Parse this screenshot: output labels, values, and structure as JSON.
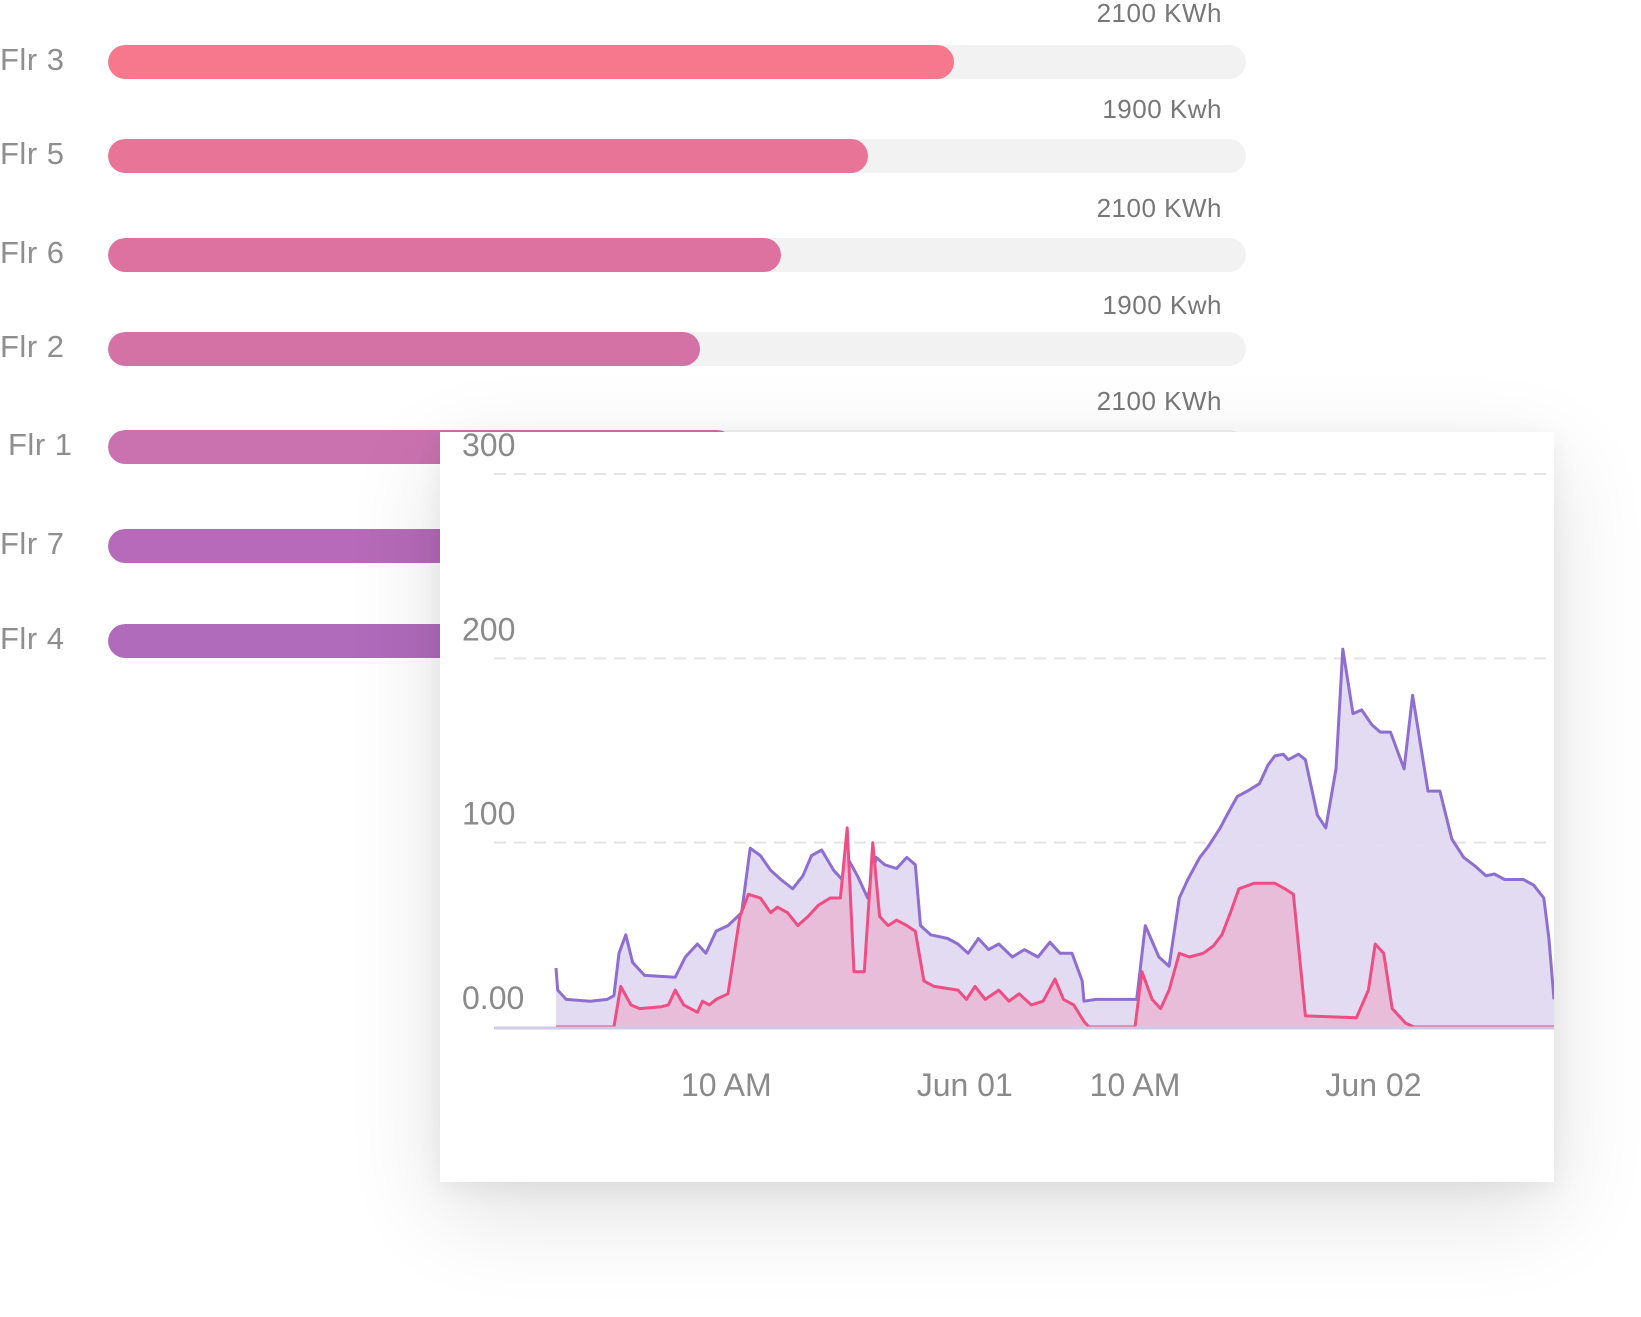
{
  "floors": [
    {
      "label": "Flr 3",
      "value_label": "2100 KWh",
      "fraction": 0.743,
      "color": "#f7778c"
    },
    {
      "label": "Flr 5",
      "value_label": "1900 Kwh",
      "fraction": 0.668,
      "color": "#e87498"
    },
    {
      "label": "Flr 6",
      "value_label": "2100 KWh",
      "fraction": 0.591,
      "color": "#dd72a0"
    },
    {
      "label": "Flr 2",
      "value_label": "1900 Kwh",
      "fraction": 0.52,
      "color": "#d472a6"
    },
    {
      "label": "Flr 1",
      "value_label": "2100 KWh",
      "fraction": null,
      "color": "#ca72b0"
    },
    {
      "label": "Flr 7",
      "value_label": "",
      "fraction": null,
      "color": "#b66ab9"
    },
    {
      "label": "Flr 4",
      "value_label": "",
      "fraction": null,
      "color": "#b06bbb"
    }
  ],
  "chart_data": {
    "type": "area",
    "title": "",
    "xlabel": "",
    "ylabel": "",
    "ylim": [
      0,
      300
    ],
    "y_ticks": [
      "0.00",
      "100",
      "200",
      "300"
    ],
    "y_tick_values": [
      0,
      100,
      200,
      300
    ],
    "x_ticks": [
      "10 AM",
      "Jun 01",
      "10 AM",
      "Jun 02"
    ],
    "x_tick_values": [
      10,
      24,
      34,
      48
    ],
    "x_range": [
      0,
      58.6
    ],
    "grid": true,
    "series": [
      {
        "color": "#8e6fd1",
        "fill": "#e0d9f0",
        "points": [
          [
            0.0,
            32
          ],
          [
            0.1,
            20
          ],
          [
            0.6,
            15
          ],
          [
            2.0,
            14
          ],
          [
            3.0,
            15
          ],
          [
            3.4,
            17
          ],
          [
            3.7,
            40
          ],
          [
            4.1,
            50
          ],
          [
            4.5,
            35
          ],
          [
            5.2,
            28
          ],
          [
            7.0,
            27
          ],
          [
            7.6,
            38
          ],
          [
            8.3,
            45
          ],
          [
            8.8,
            40
          ],
          [
            9.4,
            52
          ],
          [
            10.1,
            55
          ],
          [
            10.9,
            62
          ],
          [
            11.4,
            97
          ],
          [
            12.0,
            93
          ],
          [
            12.6,
            85
          ],
          [
            13.2,
            80
          ],
          [
            13.9,
            75
          ],
          [
            14.5,
            82
          ],
          [
            15.0,
            93
          ],
          [
            15.6,
            96
          ],
          [
            16.3,
            85
          ],
          [
            16.8,
            80
          ],
          [
            17.1,
            92
          ],
          [
            17.7,
            82
          ],
          [
            18.3,
            70
          ],
          [
            18.8,
            92
          ],
          [
            19.3,
            88
          ],
          [
            20.0,
            86
          ],
          [
            20.6,
            92
          ],
          [
            21.1,
            88
          ],
          [
            21.4,
            55
          ],
          [
            22.0,
            50
          ],
          [
            23.0,
            48
          ],
          [
            23.6,
            45
          ],
          [
            24.2,
            40
          ],
          [
            24.8,
            48
          ],
          [
            25.4,
            42
          ],
          [
            26.0,
            45
          ],
          [
            26.8,
            38
          ],
          [
            27.5,
            42
          ],
          [
            28.3,
            38
          ],
          [
            29.0,
            46
          ],
          [
            29.6,
            40
          ],
          [
            30.3,
            40
          ],
          [
            30.9,
            25
          ],
          [
            31.0,
            14
          ],
          [
            31.7,
            15
          ],
          [
            34.1,
            15
          ],
          [
            34.6,
            55
          ],
          [
            35.4,
            38
          ],
          [
            36.0,
            33
          ],
          [
            36.6,
            70
          ],
          [
            37.1,
            80
          ],
          [
            37.8,
            92
          ],
          [
            38.3,
            98
          ],
          [
            39.0,
            108
          ],
          [
            39.4,
            115
          ],
          [
            40.0,
            125
          ],
          [
            40.6,
            128
          ],
          [
            41.3,
            132
          ],
          [
            41.8,
            142
          ],
          [
            42.2,
            147
          ],
          [
            42.7,
            148
          ],
          [
            43.0,
            145
          ],
          [
            43.6,
            148
          ],
          [
            44.0,
            145
          ],
          [
            44.7,
            115
          ],
          [
            45.2,
            108
          ],
          [
            45.8,
            140
          ],
          [
            46.2,
            205
          ],
          [
            46.8,
            170
          ],
          [
            47.3,
            172
          ],
          [
            47.9,
            164
          ],
          [
            48.4,
            160
          ],
          [
            49.0,
            160
          ],
          [
            49.8,
            140
          ],
          [
            50.3,
            180
          ],
          [
            51.2,
            128
          ],
          [
            51.9,
            128
          ],
          [
            52.6,
            102
          ],
          [
            53.3,
            92
          ],
          [
            54.0,
            87
          ],
          [
            54.6,
            82
          ],
          [
            55.1,
            83
          ],
          [
            55.7,
            80
          ],
          [
            56.8,
            80
          ],
          [
            57.4,
            77
          ],
          [
            58.0,
            70
          ],
          [
            58.3,
            48
          ],
          [
            58.6,
            15
          ]
        ]
      },
      {
        "color": "#ee4e83",
        "fill": "#e8b9d7",
        "points": [
          [
            0.0,
            0
          ],
          [
            3.4,
            0
          ],
          [
            3.8,
            22
          ],
          [
            4.4,
            12
          ],
          [
            4.9,
            10
          ],
          [
            6.2,
            11
          ],
          [
            6.6,
            12
          ],
          [
            7.0,
            20
          ],
          [
            7.5,
            12
          ],
          [
            7.9,
            10
          ],
          [
            8.3,
            8
          ],
          [
            8.6,
            14
          ],
          [
            9.0,
            12
          ],
          [
            9.4,
            15
          ],
          [
            10.1,
            18
          ],
          [
            10.8,
            60
          ],
          [
            11.3,
            72
          ],
          [
            12.0,
            70
          ],
          [
            12.6,
            62
          ],
          [
            13.0,
            65
          ],
          [
            13.6,
            62
          ],
          [
            14.2,
            55
          ],
          [
            14.8,
            60
          ],
          [
            15.4,
            66
          ],
          [
            16.1,
            70
          ],
          [
            16.7,
            70
          ],
          [
            17.1,
            108
          ],
          [
            17.5,
            30
          ],
          [
            18.1,
            30
          ],
          [
            18.6,
            100
          ],
          [
            19.0,
            60
          ],
          [
            19.5,
            55
          ],
          [
            20.0,
            58
          ],
          [
            20.6,
            55
          ],
          [
            21.1,
            52
          ],
          [
            21.6,
            25
          ],
          [
            22.2,
            22
          ],
          [
            23.6,
            20
          ],
          [
            24.1,
            15
          ],
          [
            24.6,
            22
          ],
          [
            25.2,
            15
          ],
          [
            26.0,
            20
          ],
          [
            26.6,
            14
          ],
          [
            27.2,
            18
          ],
          [
            27.9,
            12
          ],
          [
            28.6,
            14
          ],
          [
            29.3,
            26
          ],
          [
            29.8,
            15
          ],
          [
            30.4,
            12
          ],
          [
            31.0,
            3
          ],
          [
            31.3,
            0
          ],
          [
            34.0,
            0
          ],
          [
            34.4,
            30
          ],
          [
            35.0,
            15
          ],
          [
            35.5,
            10
          ],
          [
            36.0,
            20
          ],
          [
            36.6,
            40
          ],
          [
            37.2,
            38
          ],
          [
            38.0,
            40
          ],
          [
            38.6,
            44
          ],
          [
            39.1,
            50
          ],
          [
            39.6,
            62
          ],
          [
            40.1,
            75
          ],
          [
            41.0,
            78
          ],
          [
            42.2,
            78
          ],
          [
            42.8,
            75
          ],
          [
            43.3,
            72
          ],
          [
            44.0,
            6
          ],
          [
            47.0,
            5
          ],
          [
            47.7,
            20
          ],
          [
            48.1,
            45
          ],
          [
            48.6,
            40
          ],
          [
            49.1,
            10
          ],
          [
            49.9,
            2
          ],
          [
            50.4,
            0
          ],
          [
            58.6,
            0
          ]
        ]
      }
    ]
  }
}
